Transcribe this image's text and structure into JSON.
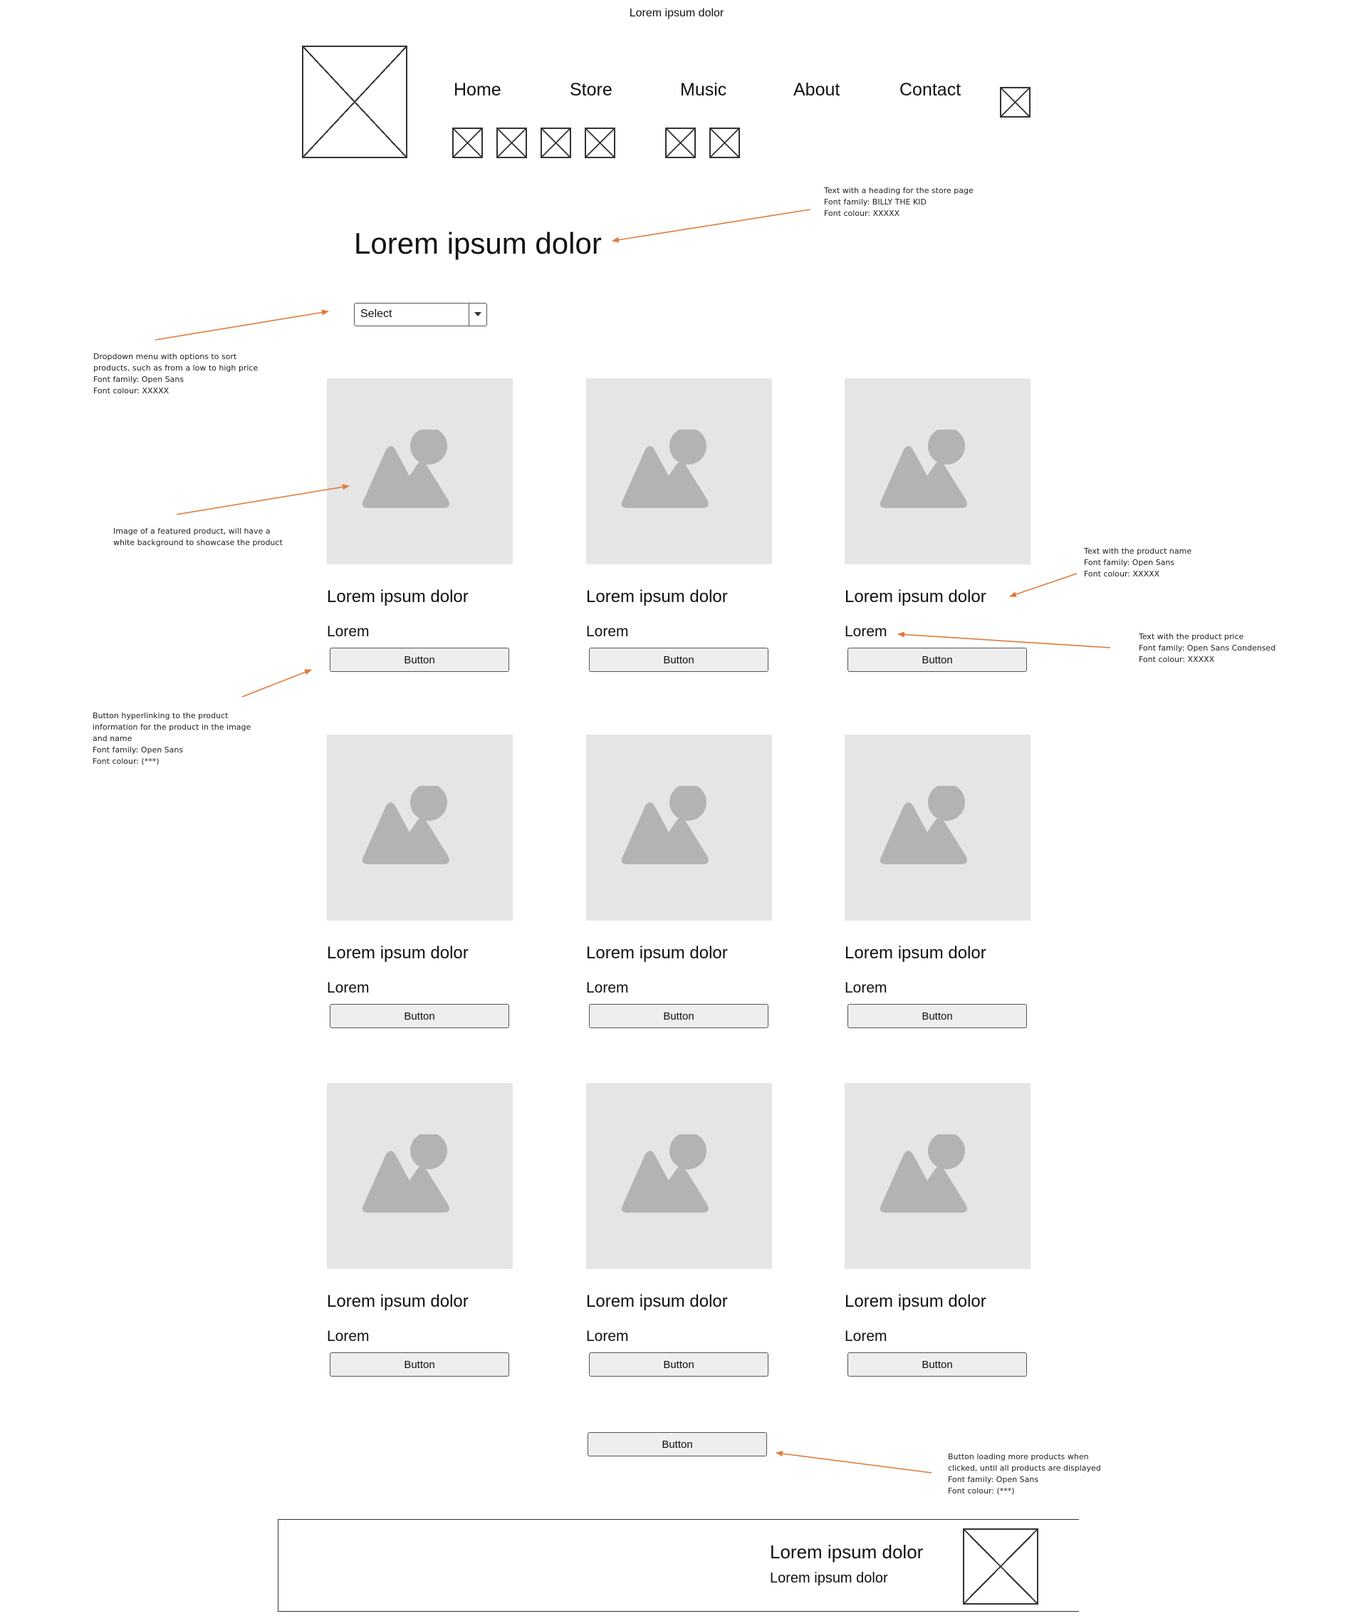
{
  "header": {
    "top_title": "Lorem ipsum dolor",
    "nav": [
      "Home",
      "Store",
      "Music",
      "About",
      "Contact"
    ]
  },
  "main": {
    "heading": "Lorem ipsum dolor",
    "sort": {
      "selected": "Select"
    },
    "products": [
      {
        "name": "Lorem ipsum dolor",
        "price": "Lorem",
        "button": "Button"
      },
      {
        "name": "Lorem ipsum dolor",
        "price": "Lorem",
        "button": "Button"
      },
      {
        "name": "Lorem ipsum dolor",
        "price": "Lorem",
        "button": "Button"
      },
      {
        "name": "Lorem ipsum dolor",
        "price": "Lorem",
        "button": "Button"
      },
      {
        "name": "Lorem ipsum dolor",
        "price": "Lorem",
        "button": "Button"
      },
      {
        "name": "Lorem ipsum dolor",
        "price": "Lorem",
        "button": "Button"
      },
      {
        "name": "Lorem ipsum dolor",
        "price": "Lorem",
        "button": "Button"
      },
      {
        "name": "Lorem ipsum dolor",
        "price": "Lorem",
        "button": "Button"
      },
      {
        "name": "Lorem ipsum dolor",
        "price": "Lorem",
        "button": "Button"
      }
    ],
    "load_more": "Button"
  },
  "annotations": {
    "heading": "Text with a heading for the store page\nFont family: BILLY THE KID\nFont colour: XXXXX",
    "dropdown": "Dropdown menu  with options to sort\nproducts, such as from a low to high price\nFont family: Open Sans\nFont colour: XXXXX",
    "image": "Image of a featured product, will have a\nwhite background to showcase the product",
    "product_name": "Text with the product name\nFont family: Open Sans\nFont colour: XXXXX",
    "product_price": "Text with the product price\nFont family: Open Sans Condensed\nFont colour: XXXXX",
    "button": "Button hyperlinking to the product\ninformation for the product in the image\nand name\nFont family: Open Sans\nFont colour: (***)",
    "load_more": "Button loading more products when\nclicked, until all products are displayed\n Font family: Open Sans\nFont colour: (***)"
  },
  "footer": {
    "title": "Lorem ipsum dolor",
    "subtitle": "Lorem ipsum dolor"
  },
  "colors": {
    "annotation_arrow": "#e07b39",
    "image_placeholder_bg": "#e5e5e5",
    "image_placeholder_icon": "#b3b3b3",
    "button_bg": "#eeeeee"
  }
}
